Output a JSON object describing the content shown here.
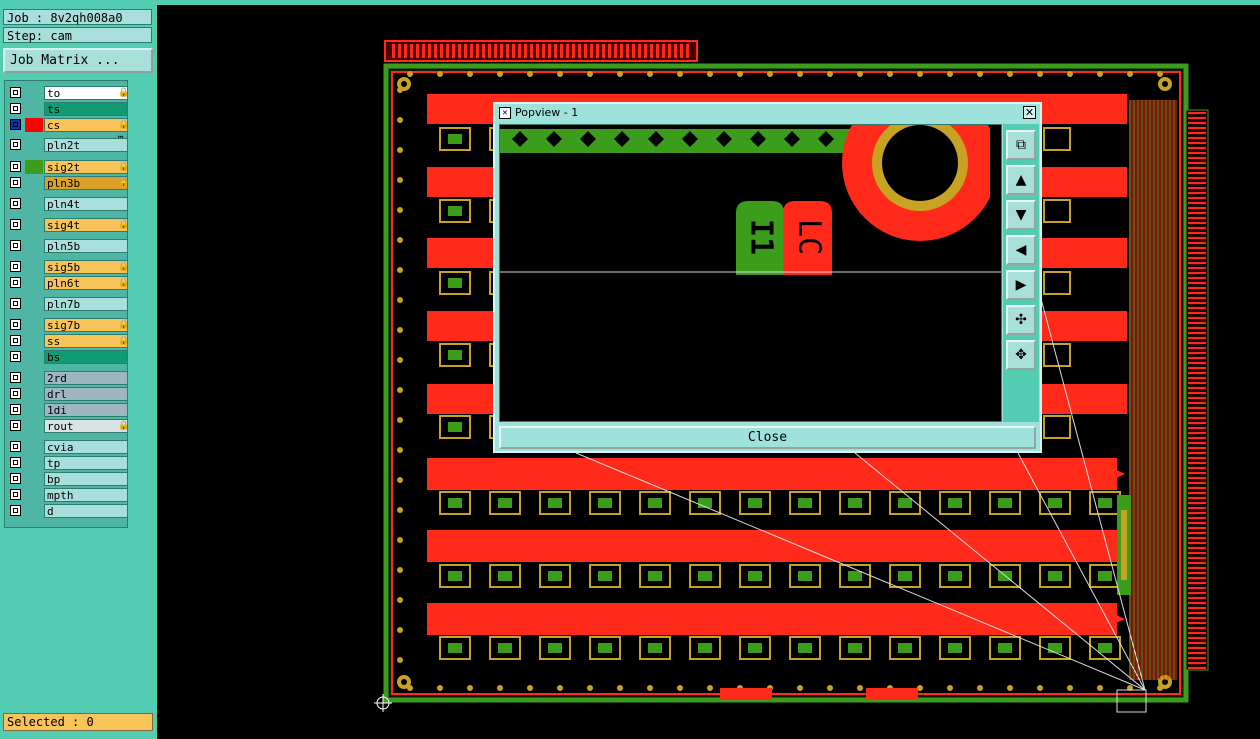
{
  "header": {
    "job": "Job : 8v2qh008a0",
    "step": "Step: cam",
    "job_matrix_label": "Job Matrix ..."
  },
  "layers": [
    {
      "name": "to",
      "color": "#ffffff",
      "mark": "🔒"
    },
    {
      "name": "ts",
      "color": "#129a74",
      "mark": ""
    },
    {
      "name": "cs",
      "color": "#f8c45a",
      "mark": "🔒 ⊞"
    },
    {
      "name": "pln2t",
      "color": "#a9dfda",
      "mark": ""
    },
    {
      "name": "sig2t",
      "color": "#f8c45a",
      "mark": "🔒"
    },
    {
      "name": "pln3b",
      "color": "#dba227",
      "mark": "🔒"
    },
    {
      "name": "pln4t",
      "color": "#a9dfda",
      "mark": ""
    },
    {
      "name": "sig4t",
      "color": "#f8c45a",
      "mark": "🔒"
    },
    {
      "name": "pln5b",
      "color": "#a9dfda",
      "mark": ""
    },
    {
      "name": "sig5b",
      "color": "#f8c45a",
      "mark": "🔒"
    },
    {
      "name": "pln6t",
      "color": "#f8c45a",
      "mark": "🔒"
    },
    {
      "name": "pln7b",
      "color": "#a9dfda",
      "mark": ""
    },
    {
      "name": "sig7b",
      "color": "#f8c45a",
      "mark": "🔒"
    },
    {
      "name": "ss",
      "color": "#f8c45a",
      "mark": "🔒"
    },
    {
      "name": "bs",
      "color": "#129a74",
      "mark": ""
    },
    {
      "name": "2rd",
      "color": "#9eb6c0",
      "mark": ""
    },
    {
      "name": "drl",
      "color": "#9eb6c0",
      "mark": ""
    },
    {
      "name": "1di",
      "color": "#9eb6c0",
      "mark": ""
    },
    {
      "name": "rout",
      "color": "#d9e3e3",
      "mark": "🔒"
    },
    {
      "name": "cvia",
      "color": "#a9dfda",
      "mark": ""
    },
    {
      "name": "tp",
      "color": "#a9dfda",
      "mark": ""
    },
    {
      "name": "bp",
      "color": "#a9dfda",
      "mark": ""
    },
    {
      "name": "mpth",
      "color": "#a9dfda",
      "mark": ""
    },
    {
      "name": "d",
      "color": "#a9dfda",
      "mark": ""
    }
  ],
  "status": {
    "selected": "Selected : 0"
  },
  "popview": {
    "title": "Popview - 1",
    "close_label": "Close",
    "labels": [
      "I1",
      "LC"
    ]
  },
  "tools": [
    "zoom-home-icon",
    "pan-up-icon",
    "pan-down-icon",
    "pan-left-icon",
    "pan-right-icon",
    "zoom-in-icon",
    "zoom-out-icon"
  ],
  "colors": {
    "panel": "#52cdb2",
    "copper": "#ff2a1a",
    "silk": "#c8a222",
    "mask": "#3c9c1c"
  }
}
